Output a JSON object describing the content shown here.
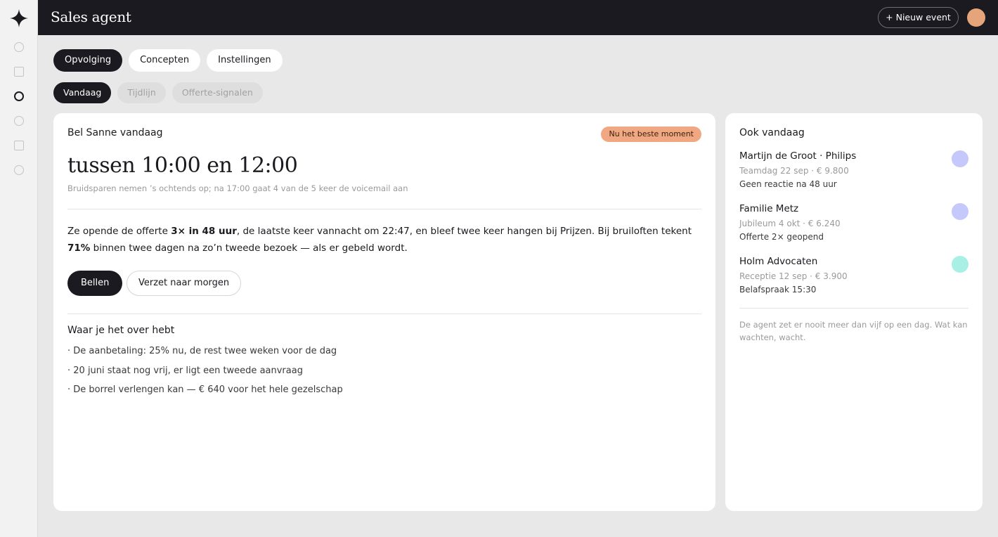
{
  "app": {
    "title": "Sales agent",
    "new_event_label": "+ Nieuw event",
    "avatar_color": "#e6a47a"
  },
  "sidebar": {
    "logo_icon": "four-point-star-icon",
    "items": [
      {
        "name": "nav-item-1",
        "shape": "circle",
        "active": false
      },
      {
        "name": "nav-item-2",
        "shape": "square",
        "active": false
      },
      {
        "name": "nav-item-3",
        "shape": "circle",
        "active": true
      },
      {
        "name": "nav-item-4",
        "shape": "circle",
        "active": false
      },
      {
        "name": "nav-item-5",
        "shape": "square",
        "active": false
      },
      {
        "name": "nav-item-6",
        "shape": "circle",
        "active": false
      }
    ]
  },
  "tabs": [
    {
      "label": "Opvolging",
      "active": true
    },
    {
      "label": "Concepten",
      "active": false
    },
    {
      "label": "Instellingen",
      "active": false
    }
  ],
  "subtabs": [
    {
      "label": "Vandaag",
      "active": true
    },
    {
      "label": "Tijdlijn",
      "active": false
    },
    {
      "label": "Offerte-signalen",
      "active": false
    }
  ],
  "main": {
    "heading": "Bel Sanne vandaag",
    "badge": "Nu het beste moment",
    "badge_color": "#f0a882",
    "time_window": "tussen 10:00 en 12:00",
    "time_note": "Bruidsparen nemen ’s ochtends op; na 17:00 gaat 4 van de 5 keer de voicemail aan",
    "body": {
      "part1": "Ze opende de offerte ",
      "bold1": "3× in 48 uur",
      "part2": ", de laatste keer vannacht om 22:47, en bleef twee keer hangen bij Prijzen. Bij bruiloften tekent ",
      "bold2": "71%",
      "part3": " binnen twee dagen na zo’n tweede bezoek — als er gebeld wordt."
    },
    "call_label": "Bellen",
    "postpone_label": "Verzet naar morgen",
    "talk_heading": "Waar je het over hebt",
    "talking_points": [
      "· De aanbetaling: 25% nu, de rest twee weken voor de dag",
      "· 20 juni staat nog vrij, er ligt een tweede aanvraag",
      "· De borrel verlengen kan — € 640 voor het hele gezelschap"
    ]
  },
  "side": {
    "heading": "Ook vandaag",
    "contacts": [
      {
        "name": "Martijn de Groot · Philips",
        "meta": "Teamdag 22 sep · € 9.800",
        "status": "Geen reactie na 48 uur",
        "color": "#c5c8fa"
      },
      {
        "name": "Familie Metz",
        "meta": "Jubileum 4 okt · € 6.240",
        "status": "Offerte 2× geopend",
        "color": "#c5c8fa"
      },
      {
        "name": "Holm Advocaten",
        "meta": "Receptie 12 sep · € 3.900",
        "status": "Belafspraak 15:30",
        "color": "#a8f0e6"
      }
    ],
    "note": "De agent zet er nooit meer dan vijf op een dag. Wat kan wachten, wacht."
  }
}
